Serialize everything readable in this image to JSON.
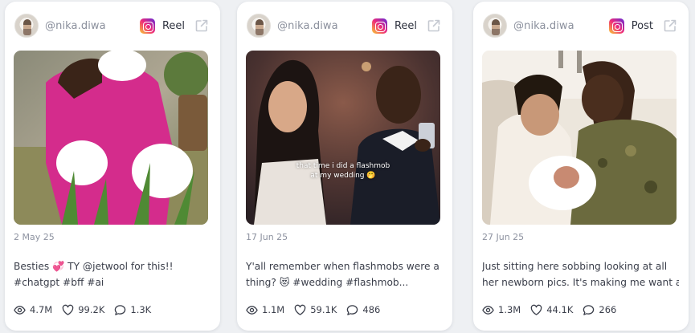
{
  "posts": [
    {
      "handle": "@nika.diwa",
      "type": "Reel",
      "date": "2 May 25",
      "caption_lines": [
        "Besties 💞 TY @jetwool for this!!",
        "#chatgpt #bff #ai"
      ],
      "views": "4.7M",
      "likes": "99.2K",
      "comments": "1.3K",
      "overlay": ""
    },
    {
      "handle": "@nika.diwa",
      "type": "Reel",
      "date": "17 Jun 25",
      "caption_lines": [
        "Y'all remember when flashmobs were a",
        "thing? 😻 #wedding #flashmob..."
      ],
      "views": "1.1M",
      "likes": "59.1K",
      "comments": "486",
      "overlay": "that time i did a flashmob\nat my wedding 🤭"
    },
    {
      "handle": "@nika.diwa",
      "type": "Post",
      "date": "27 Jun 25",
      "caption_lines": [
        "Just sitting here sobbing looking at all",
        "her newborn pics. It's making me want a..."
      ],
      "views": "1.3M",
      "likes": "44.1K",
      "comments": "266",
      "overlay": ""
    }
  ],
  "icons": {
    "platform": "instagram-icon",
    "open": "external-link-icon",
    "views": "eye-icon",
    "likes": "heart-icon",
    "comments": "comment-icon"
  },
  "colors": {
    "background": "#eef0f3",
    "card": "#ffffff",
    "muted_text": "#8a8f9c",
    "text": "#3a3e4a"
  }
}
